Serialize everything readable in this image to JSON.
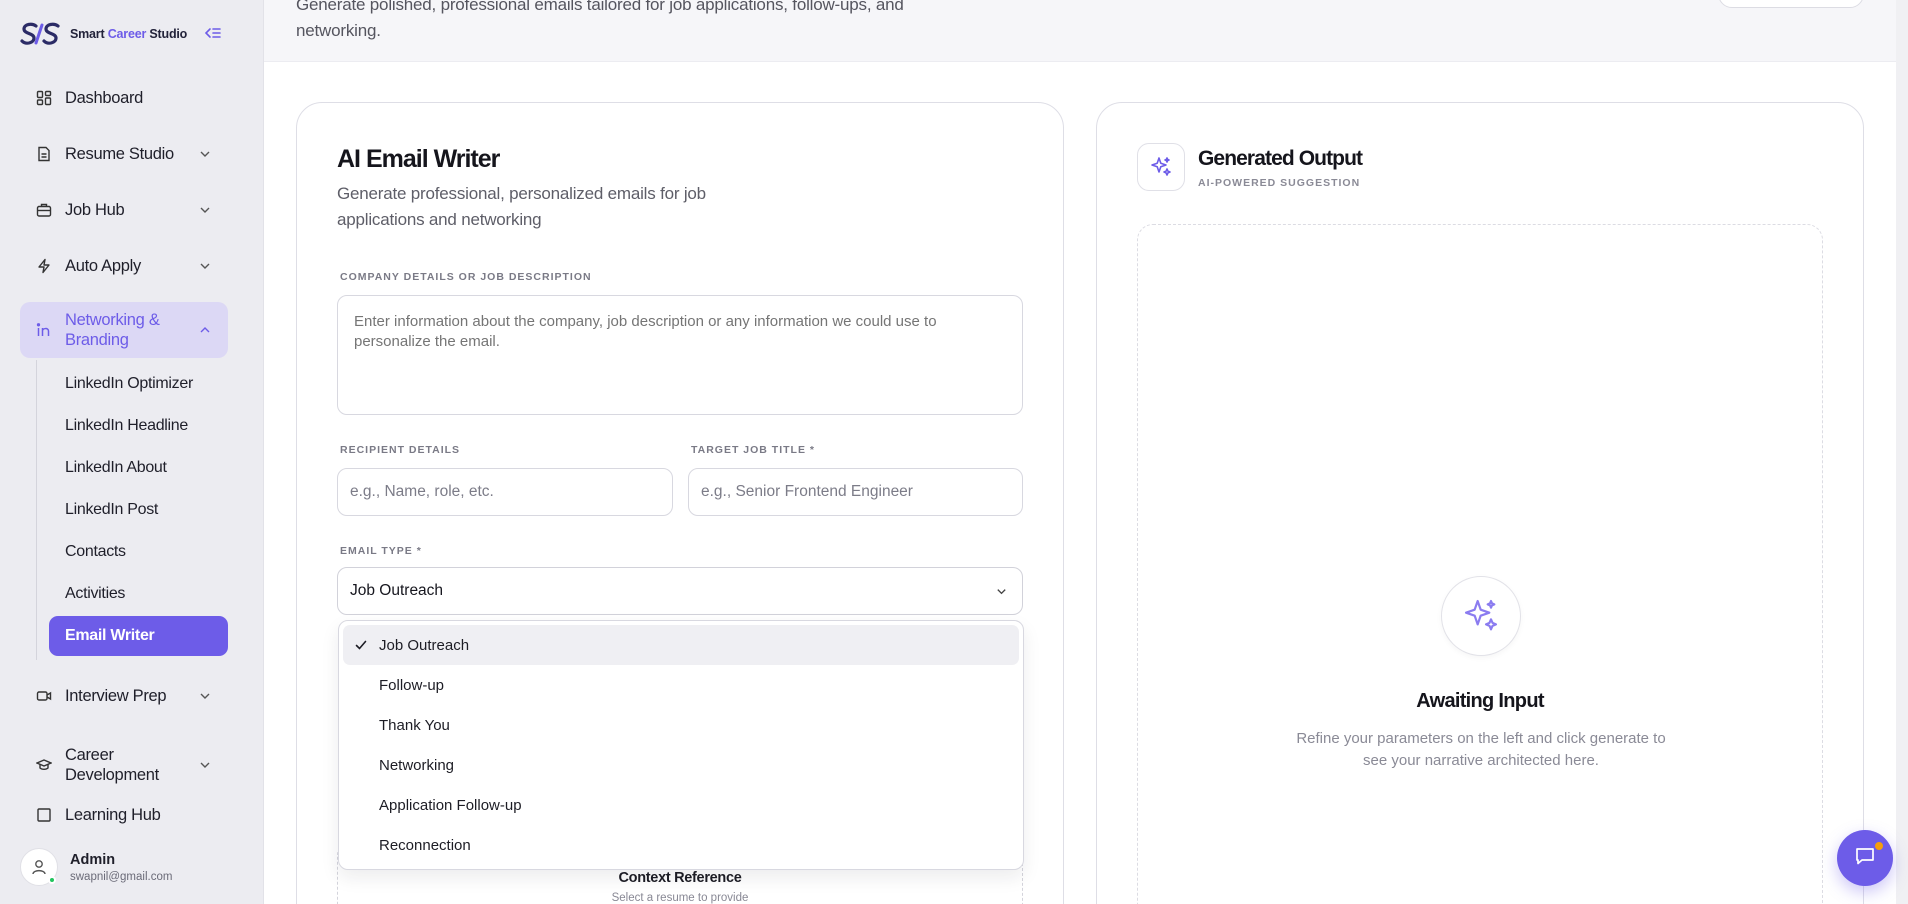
{
  "brand": {
    "name_part1": "Smart ",
    "name_accent": "Career",
    "name_part2": " Studio"
  },
  "sidebar": {
    "items": [
      {
        "label": "Dashboard",
        "icon": "grid-icon"
      },
      {
        "label": "Resume Studio",
        "icon": "document-icon"
      },
      {
        "label": "Job Hub",
        "icon": "briefcase-icon"
      },
      {
        "label": "Auto Apply",
        "icon": "lightning-icon"
      },
      {
        "label": "Networking & Branding",
        "icon": "linkedin-icon"
      },
      {
        "label": "Interview Prep",
        "icon": "video-icon"
      },
      {
        "label": "Career Development",
        "icon": "graduation-cap-icon"
      },
      {
        "label": "Learning Hub",
        "icon": "book-icon"
      }
    ],
    "sub_items": [
      "LinkedIn Optimizer",
      "LinkedIn Headline",
      "LinkedIn About",
      "LinkedIn Post",
      "Contacts",
      "Activities",
      "Email Writer"
    ],
    "active_sub": "Email Writer"
  },
  "user": {
    "name": "Admin",
    "email": "swapnil@gmail.com"
  },
  "topbar": {
    "description": "Generate polished, professional emails tailored for job applications, follow-ups, and networking."
  },
  "form": {
    "title": "AI Email Writer",
    "subtitle": "Generate professional, personalized emails for job applications and networking",
    "company_label": "COMPANY DETAILS OR JOB DESCRIPTION",
    "company_placeholder": "Enter information about the company, job description or any information we could use to personalize the email.",
    "recipient_label": "RECIPIENT DETAILS",
    "recipient_placeholder": "e.g., Name, role, etc.",
    "job_title_label": "TARGET JOB TITLE *",
    "job_title_placeholder": "e.g., Senior Frontend Engineer",
    "email_type_label": "EMAIL TYPE *",
    "email_type_value": "Job Outreach",
    "email_type_options": [
      "Job Outreach",
      "Follow-up",
      "Thank You",
      "Networking",
      "Application Follow-up",
      "Reconnection"
    ],
    "context_title": "Context Reference",
    "context_sub": "Select a resume to provide"
  },
  "output": {
    "title": "Generated Output",
    "subtitle": "AI-POWERED SUGGESTION",
    "await_title": "Awaiting Input",
    "await_text": "Refine your parameters on the left and click generate to see your narrative architected here."
  },
  "colors": {
    "accent": "#6d5ce8",
    "accent_soft": "#dcd8f5",
    "online": "#22c55e"
  }
}
